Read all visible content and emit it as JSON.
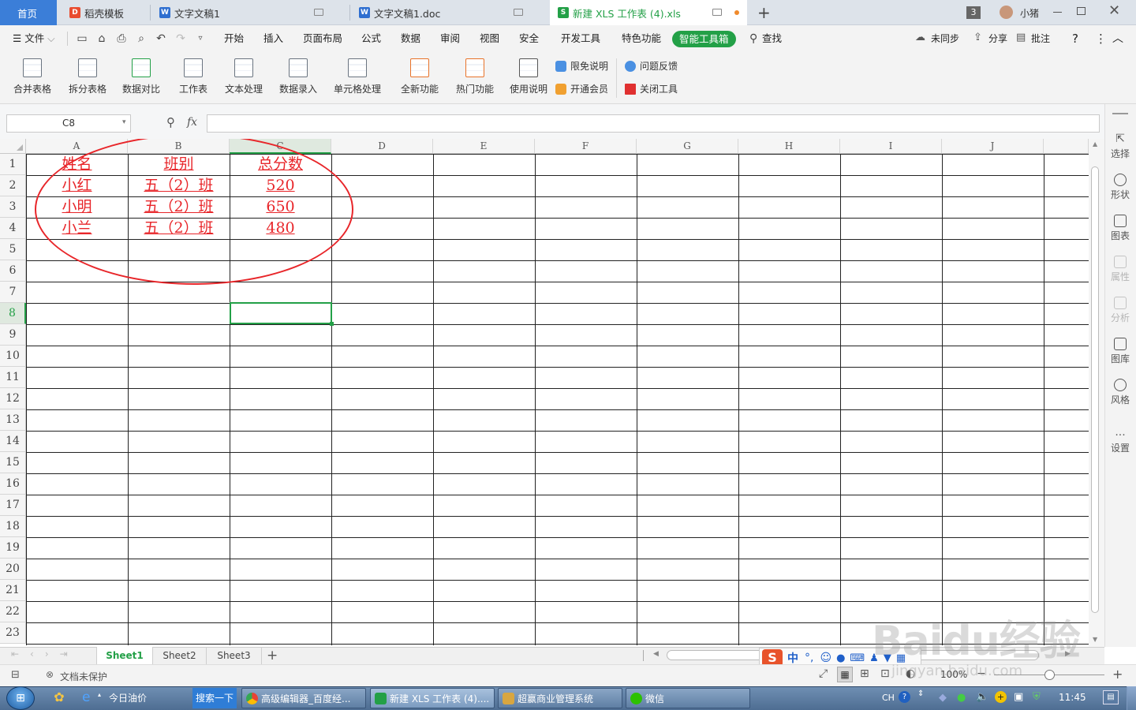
{
  "tabs": [
    {
      "label": "首页"
    },
    {
      "label": "稻壳模板"
    },
    {
      "label": "文字文稿1"
    },
    {
      "label": "文字文稿1.doc"
    },
    {
      "label": "新建 XLS 工作表 (4).xls"
    }
  ],
  "tabbar": {
    "new_tab": "+",
    "window_count": "3",
    "user_name": "小猪"
  },
  "menu": {
    "file": "文件",
    "items": [
      "开始",
      "插入",
      "页面布局",
      "公式",
      "数据",
      "审阅",
      "视图",
      "安全",
      "开发工具",
      "特色功能"
    ],
    "active": "智能工具箱",
    "search": "查找",
    "sync": "未同步",
    "share": "分享",
    "comment": "批注",
    "help": "?"
  },
  "ribbon": {
    "buttons": [
      "合并表格",
      "拆分表格",
      "数据对比",
      "工作表",
      "文本处理",
      "数据录入",
      "单元格处理",
      "全新功能",
      "热门功能",
      "使用说明"
    ],
    "small": [
      "限免说明",
      "开通会员",
      "问题反馈",
      "关闭工具"
    ]
  },
  "formula": {
    "cell_ref": "C8",
    "fx": "fx",
    "content": ""
  },
  "sheet": {
    "columns": [
      "A",
      "B",
      "C",
      "D",
      "E",
      "F",
      "G",
      "H",
      "I",
      "J"
    ],
    "rows": [
      "1",
      "2",
      "3",
      "4",
      "5",
      "6",
      "7",
      "8",
      "9",
      "10",
      "11",
      "12",
      "13",
      "14",
      "15",
      "16",
      "17",
      "18",
      "19",
      "20",
      "21",
      "22",
      "23"
    ],
    "header": [
      "姓名",
      "班别",
      "总分数"
    ],
    "data": [
      [
        "小红",
        "五（2）班",
        "520"
      ],
      [
        "小明",
        "五（2）班",
        "650"
      ],
      [
        "小兰",
        "五（2）班",
        "480"
      ]
    ],
    "selected": "C8"
  },
  "right_panel": [
    "选择",
    "形状",
    "图表",
    "属性",
    "分析",
    "图库",
    "风格",
    "设置"
  ],
  "sheet_tabs": [
    "Sheet1",
    "Sheet2",
    "Sheet3"
  ],
  "sheet_add": "+",
  "status": {
    "protect": "文档未保护",
    "zoom": "100%"
  },
  "ime": {
    "lang": "中"
  },
  "taskbar": {
    "items": [
      "今日油价",
      "搜索一下",
      "高级编辑器_百度经...",
      "新建 XLS 工作表 (4)....",
      "超赢商业管理系统",
      "微信"
    ],
    "lang": "CH",
    "time": "11:45"
  },
  "watermark": "Baidu经验",
  "watermark_url": "jingyan.baidu.com",
  "colors": {
    "accent_green": "#23a047",
    "annotation_red": "#e8262a",
    "taskbar_blue": "#4e6d92"
  }
}
